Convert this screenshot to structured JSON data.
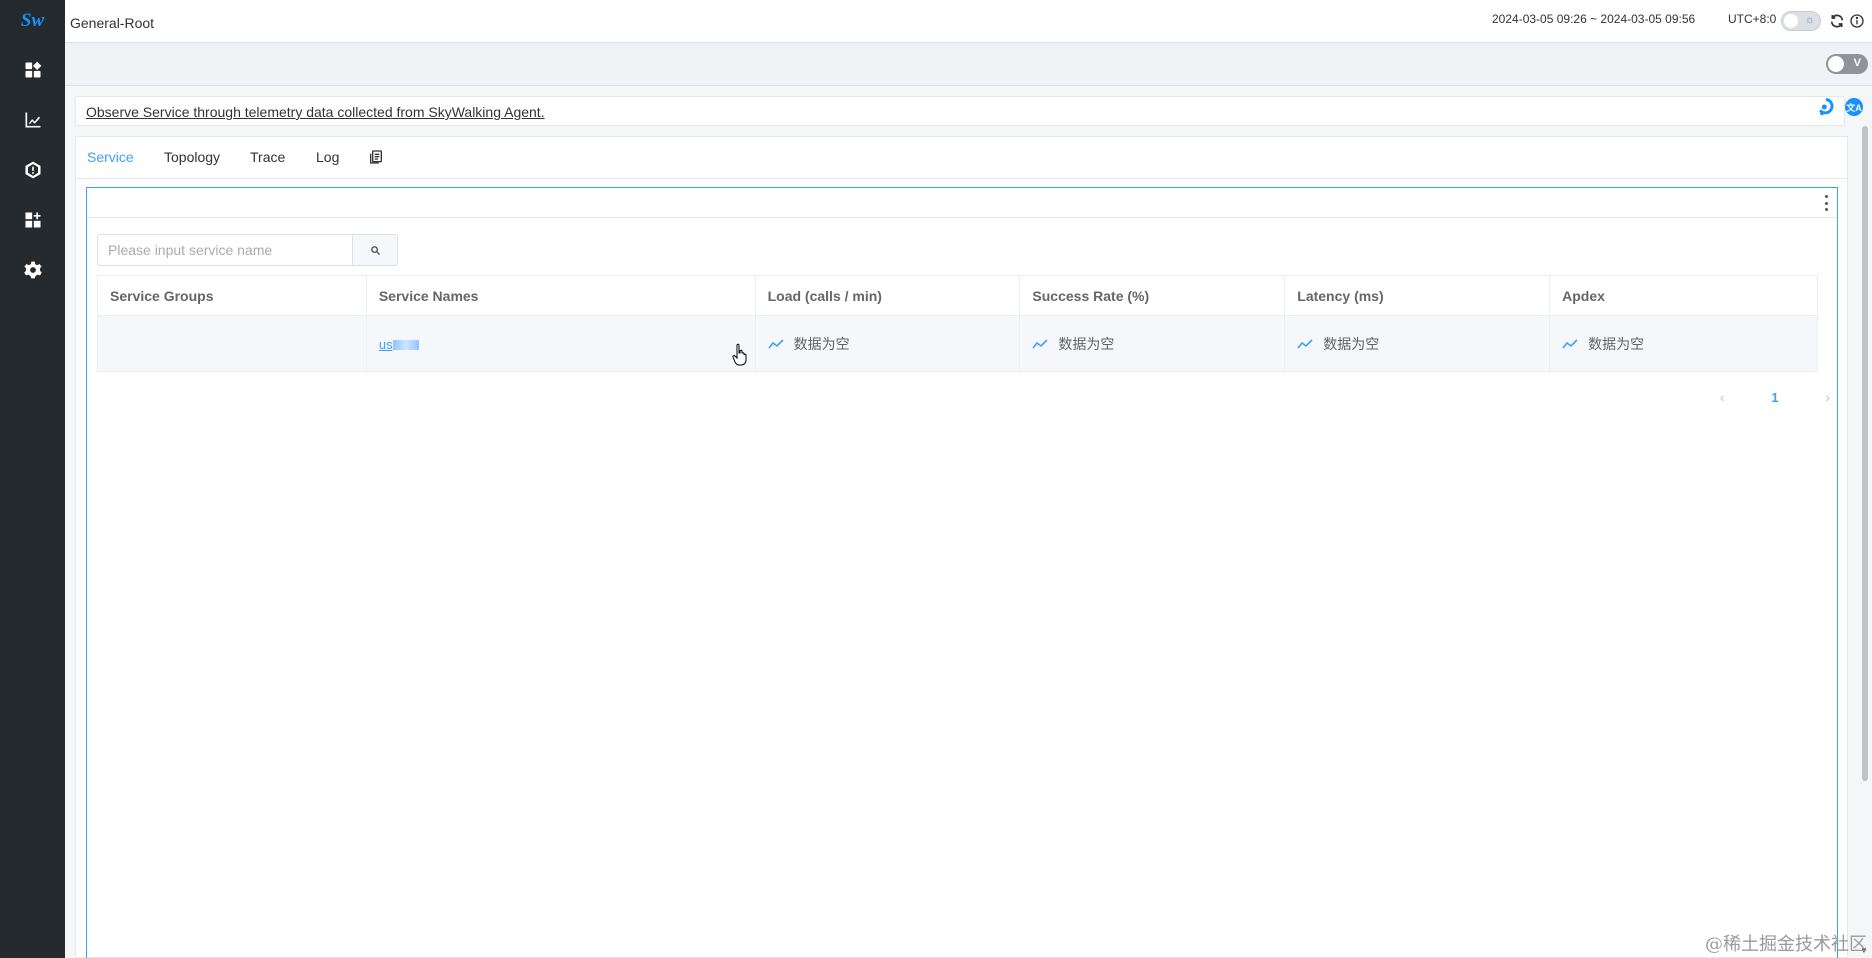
{
  "app": {
    "logo_text": "Sw",
    "title": "General-Root",
    "time_range": "2024-03-05 09:26 ~ 2024-03-05 09:56",
    "timezone": "UTC+8:0",
    "theme_icon": "sun-icon",
    "version_toggle_label": "V"
  },
  "sidebar": {
    "items": [
      {
        "name": "dashboard",
        "icon": "dashboard-icon"
      },
      {
        "name": "metrics",
        "icon": "chart-icon"
      },
      {
        "name": "alerting",
        "icon": "shield-alert-icon"
      },
      {
        "name": "marketplace",
        "icon": "widgets-add-icon"
      },
      {
        "name": "settings",
        "icon": "gear-icon"
      }
    ]
  },
  "description": {
    "text": "Observe Service through telemetry data collected from SkyWalking Agent."
  },
  "tabs": [
    {
      "label": "Service",
      "active": true
    },
    {
      "label": "Topology",
      "active": false
    },
    {
      "label": "Trace",
      "active": false
    },
    {
      "label": "Log",
      "active": false
    }
  ],
  "search": {
    "placeholder": "Please input service name",
    "value": ""
  },
  "table": {
    "headers": [
      "Service Groups",
      "Service Names",
      "Load (calls / min)",
      "Success Rate (%)",
      "Latency (ms)",
      "Apdex"
    ],
    "rows": [
      {
        "group": "",
        "service_name": "us",
        "load": "数据为空",
        "success_rate": "数据为空",
        "latency": "数据为空",
        "apdex": "数据为空"
      }
    ]
  },
  "pagination": {
    "current_page": "1"
  },
  "watermark": "@稀土掘金技术社区",
  "colors": {
    "sidebar_bg": "#252a2f",
    "accent": "#409eff"
  }
}
